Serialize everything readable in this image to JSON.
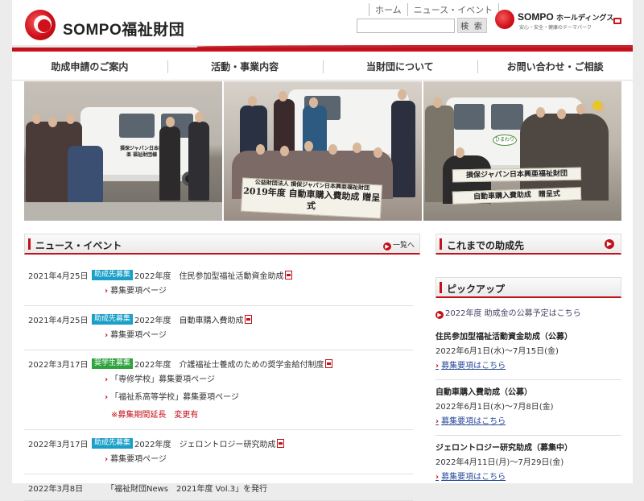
{
  "header": {
    "org_name": "SOMPO福祉財団",
    "top_links": [
      "ホーム",
      "ニュース・イベント"
    ],
    "search_placeholder": "",
    "search_button": "検 索",
    "holdings_name": "SOMPO",
    "holdings_suffix": "ホールディングス",
    "holdings_tagline": "安心・安全・健康のテーマパーク"
  },
  "mainnav": {
    "items": [
      "助成申請のご案内",
      "活動・事業内容",
      "当財団について",
      "お問い合わせ・ご相談"
    ]
  },
  "photos": {
    "banner1": "損保ジャパン日本興亜 福祉財団様",
    "banner2_org": "公益財団法人 損保ジャパン日本興亜福祉財団",
    "banner2_title": "2019年度 自動車購入費助成 贈呈式",
    "banner3_line1": "損保ジャパン日本興亜福祉財団",
    "banner3_line2": "自動車購入費助成　贈呈式",
    "van_label": "ひまわり"
  },
  "news": {
    "title": "ニュース・イベント",
    "more_label": "一覧へ",
    "items": [
      {
        "date": "2021年4月25日",
        "badge": "助成先募集",
        "title": "2022年度　住民参加型福祉活動資金助成",
        "subs": [
          "募集要項ページ"
        ],
        "note": ""
      },
      {
        "date": "2021年4月25日",
        "badge": "助成先募集",
        "title": "2022年度　自動車購入費助成",
        "subs": [
          "募集要項ページ"
        ],
        "note": ""
      },
      {
        "date": "2022年3月17日",
        "badge": "奨学生募集",
        "title": "2022年度　介護福祉士養成のための奨学金給付制度",
        "subs": [
          "「専修学校」募集要項ページ",
          "「福祉系高等学校」募集要項ページ"
        ],
        "note": "※募集期間延長　変更有"
      },
      {
        "date": "2022年3月17日",
        "badge": "助成先募集",
        "title": "2022年度　ジェロントロジー研究助成",
        "subs": [
          "募集要項ページ"
        ],
        "note": ""
      },
      {
        "date": "2022年3月8日",
        "badge": "",
        "title": "「福祉財団News　2021年度 Vol.3」を発行",
        "subs": [],
        "note": ""
      }
    ]
  },
  "sidebar": {
    "recipients_title": "これまでの助成先",
    "pickup_title": "ピックアップ",
    "pickup_link": "2022年度 助成金の公募予定はこちら",
    "picks": [
      {
        "title": "住民参加型福祉活動資金助成（公募）",
        "dates": "2022年6月1日(水)～7月15日(金)",
        "link": "募集要項はこちら"
      },
      {
        "title": "自動車購入費助成（公募）",
        "dates": "2022年6月1日(水)～7月8日(金)",
        "link": "募集要項はこちら"
      },
      {
        "title": "ジェロントロジー研究助成（募集中）",
        "dates": "2022年4月11日(月)～7月29日(金)",
        "link": "募集要項はこちら"
      }
    ]
  },
  "colors": {
    "accent": "#c3101b",
    "badge_blue": "#1a9fc7",
    "badge_green": "#2fa43e"
  }
}
